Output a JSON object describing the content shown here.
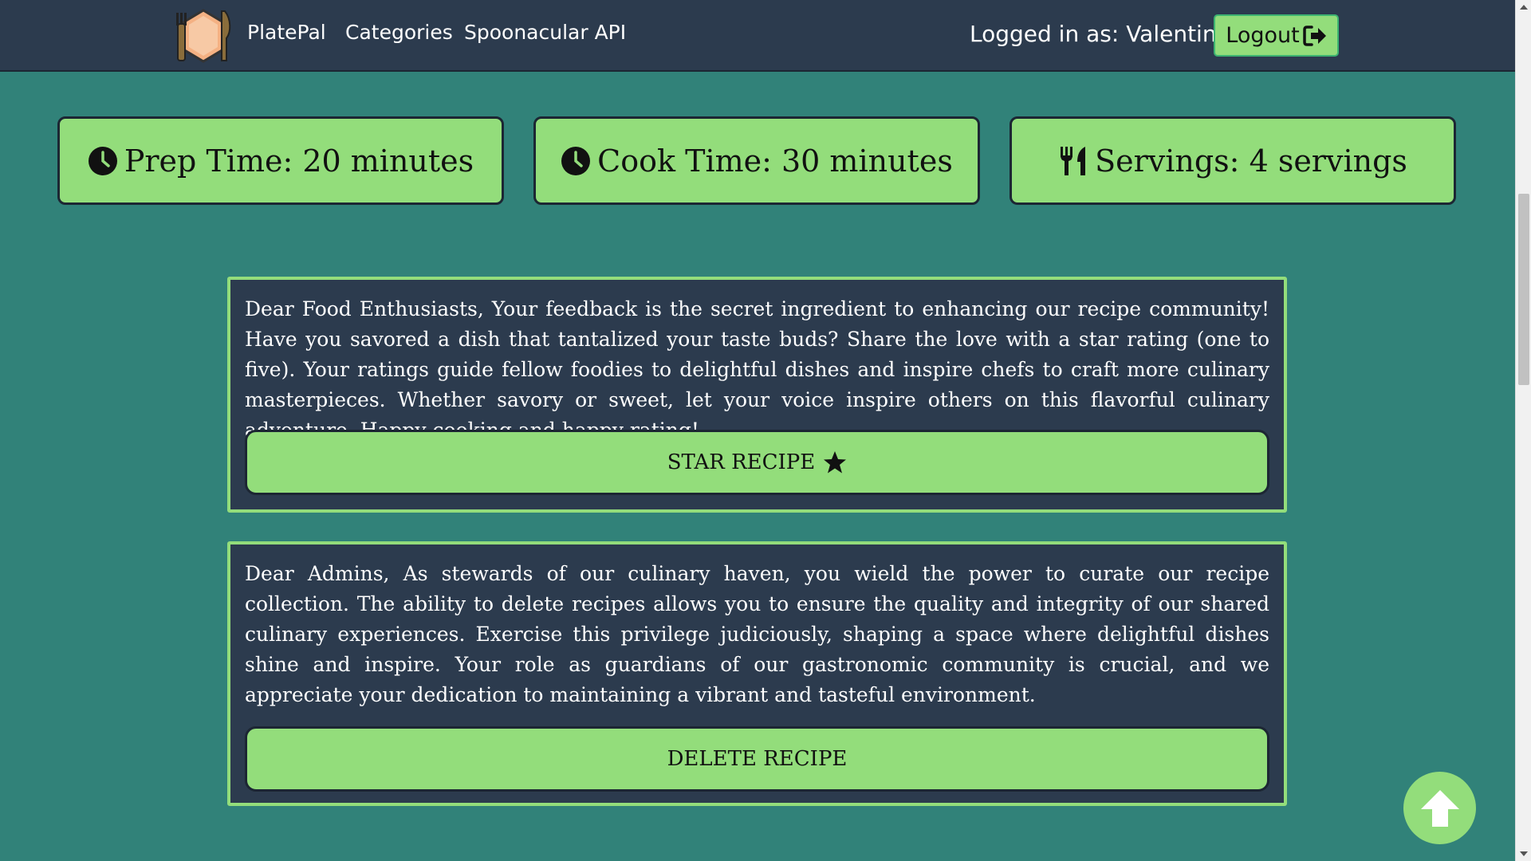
{
  "navbar": {
    "brand": "PlatePal",
    "links": [
      "Categories",
      "Spoonacular API"
    ],
    "logo_icon": "plate-fork-knife-logo",
    "user_text": "Logged in as: Valentin",
    "logout_label": "Logout",
    "logout_icon": "sign-out-icon"
  },
  "info_cards": [
    {
      "icon": "clock-icon",
      "text": "Prep Time: 20 minutes"
    },
    {
      "icon": "clock-icon",
      "text": "Cook Time: 30 minutes"
    },
    {
      "icon": "utensils-icon",
      "text": "Servings: 4 servings"
    }
  ],
  "rating_panel": {
    "message": "Dear Food Enthusiasts, Your feedback is the secret ingredient to enhancing our recipe community! Have you savored a dish that tantalized your taste buds? Share the love with a star rating (one to five). Your ratings guide fellow foodies to delightful dishes and inspire chefs to craft more culinary masterpieces. Whether savory or sweet, let your voice inspire others on this flavorful culinary adventure. Happy cooking and happy rating!",
    "button_label": "STAR RECIPE",
    "button_icon": "star-icon"
  },
  "admin_panel": {
    "message": "Dear Admins, As stewards of our culinary haven, you wield the power to curate our recipe collection. The ability to delete recipes allows you to ensure the quality and integrity of our shared culinary experiences. Exercise this privilege judiciously, shaping a space where delightful dishes shine and inspire. Your role as guardians of our gastronomic community is crucial, and we appreciate your dedication to maintaining a vibrant and tasteful environment.",
    "button_label": "DELETE RECIPE"
  },
  "scroll_top_icon": "arrow-up-icon",
  "colors": {
    "page_bg": "#318279",
    "navbar_bg": "#2c3b4e",
    "accent_green": "#93dd7b",
    "panel_bg": "#2c3b4e"
  }
}
